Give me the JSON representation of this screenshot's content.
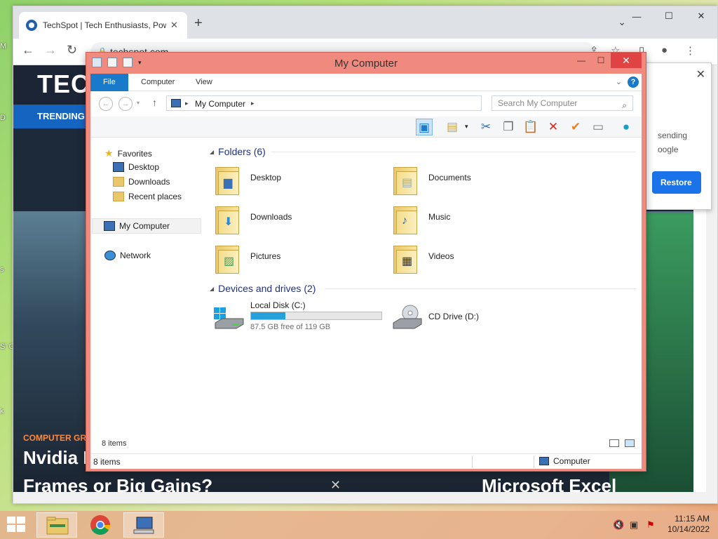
{
  "desktop": {
    "stubs": [
      "M",
      "D",
      "s",
      "S' On",
      "k"
    ]
  },
  "chrome": {
    "tab_title": "TechSpot | Tech Enthusiasts, Power",
    "tab_close": "✕",
    "new_tab": "+",
    "url": "techspot.com",
    "controls": {
      "minimize": "—",
      "maximize": "☐",
      "close": "✕"
    }
  },
  "site": {
    "logo": "TEC",
    "nav_item": "TRENDING",
    "hero_category": "COMPUTER GRA",
    "hero_title": "Nvidia I",
    "hero_title_line2": "Frames or Big Gains?",
    "hero_side_title": "Microsoft Excel",
    "popup": {
      "line1": "sending",
      "line2": "oogle",
      "restore": "Restore"
    }
  },
  "explorer": {
    "title": "My Computer",
    "ribbon_tabs": [
      "File",
      "Computer",
      "View"
    ],
    "address": "My Computer",
    "search_placeholder": "Search My Computer",
    "nav": {
      "favorites": "Favorites",
      "favorites_items": [
        "Desktop",
        "Downloads",
        "Recent places"
      ],
      "my_computer": "My Computer",
      "network": "Network"
    },
    "folders_heading": "Folders (6)",
    "folders": [
      {
        "name": "Desktop",
        "badge": "desktop"
      },
      {
        "name": "Documents",
        "badge": "documents"
      },
      {
        "name": "Downloads",
        "badge": "downloads"
      },
      {
        "name": "Music",
        "badge": "music"
      },
      {
        "name": "Pictures",
        "badge": "pictures"
      },
      {
        "name": "Videos",
        "badge": "videos"
      }
    ],
    "drives_heading": "Devices and drives (2)",
    "drives": [
      {
        "name": "Local Disk (C:)",
        "free_text": "87.5 GB free of 119 GB",
        "used_fraction": 0.265
      },
      {
        "name": "CD Drive (D:)"
      }
    ],
    "item_count": "8 items",
    "status_items": "8 items",
    "status_location": "Computer"
  },
  "taskbar": {
    "time": "11:15 AM",
    "date": "10/14/2022"
  },
  "colors": {
    "accent": "#1979ca",
    "titlebar": "#f08a7e",
    "drive_fill": "#26a0da"
  }
}
